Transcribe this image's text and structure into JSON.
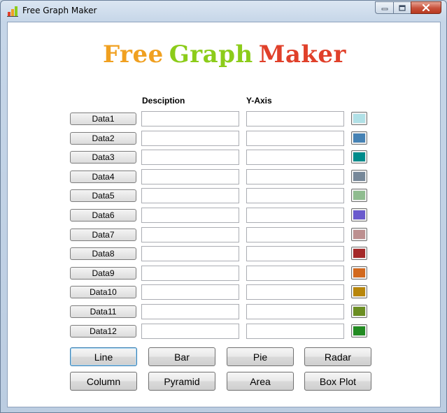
{
  "window": {
    "title": "Free Graph Maker"
  },
  "logo": {
    "words": [
      {
        "text": "Free",
        "color": "#f0a020"
      },
      {
        "text": "Graph",
        "color": "#8ccc1a"
      },
      {
        "text": "Maker",
        "color": "#e0402a"
      }
    ]
  },
  "headers": {
    "description": "Desciption",
    "yaxis": "Y-Axis"
  },
  "rows": [
    {
      "label": "Data1",
      "color": "#b0e0e6"
    },
    {
      "label": "Data2",
      "color": "#4682b4"
    },
    {
      "label": "Data3",
      "color": "#008b8b"
    },
    {
      "label": "Data4",
      "color": "#778899"
    },
    {
      "label": "Data5",
      "color": "#8fbc8f"
    },
    {
      "label": "Data6",
      "color": "#6a5acd"
    },
    {
      "label": "Data7",
      "color": "#bc8f8f"
    },
    {
      "label": "Data8",
      "color": "#a52a2a"
    },
    {
      "label": "Data9",
      "color": "#d2691e"
    },
    {
      "label": "Data10",
      "color": "#b8860b"
    },
    {
      "label": "Data11",
      "color": "#6b8e23"
    },
    {
      "label": "Data12",
      "color": "#228b22"
    }
  ],
  "chart_buttons": {
    "line": "Line",
    "bar": "Bar",
    "pie": "Pie",
    "radar": "Radar",
    "column": "Column",
    "pyramid": "Pyramid",
    "area": "Area",
    "boxplot": "Box Plot"
  }
}
